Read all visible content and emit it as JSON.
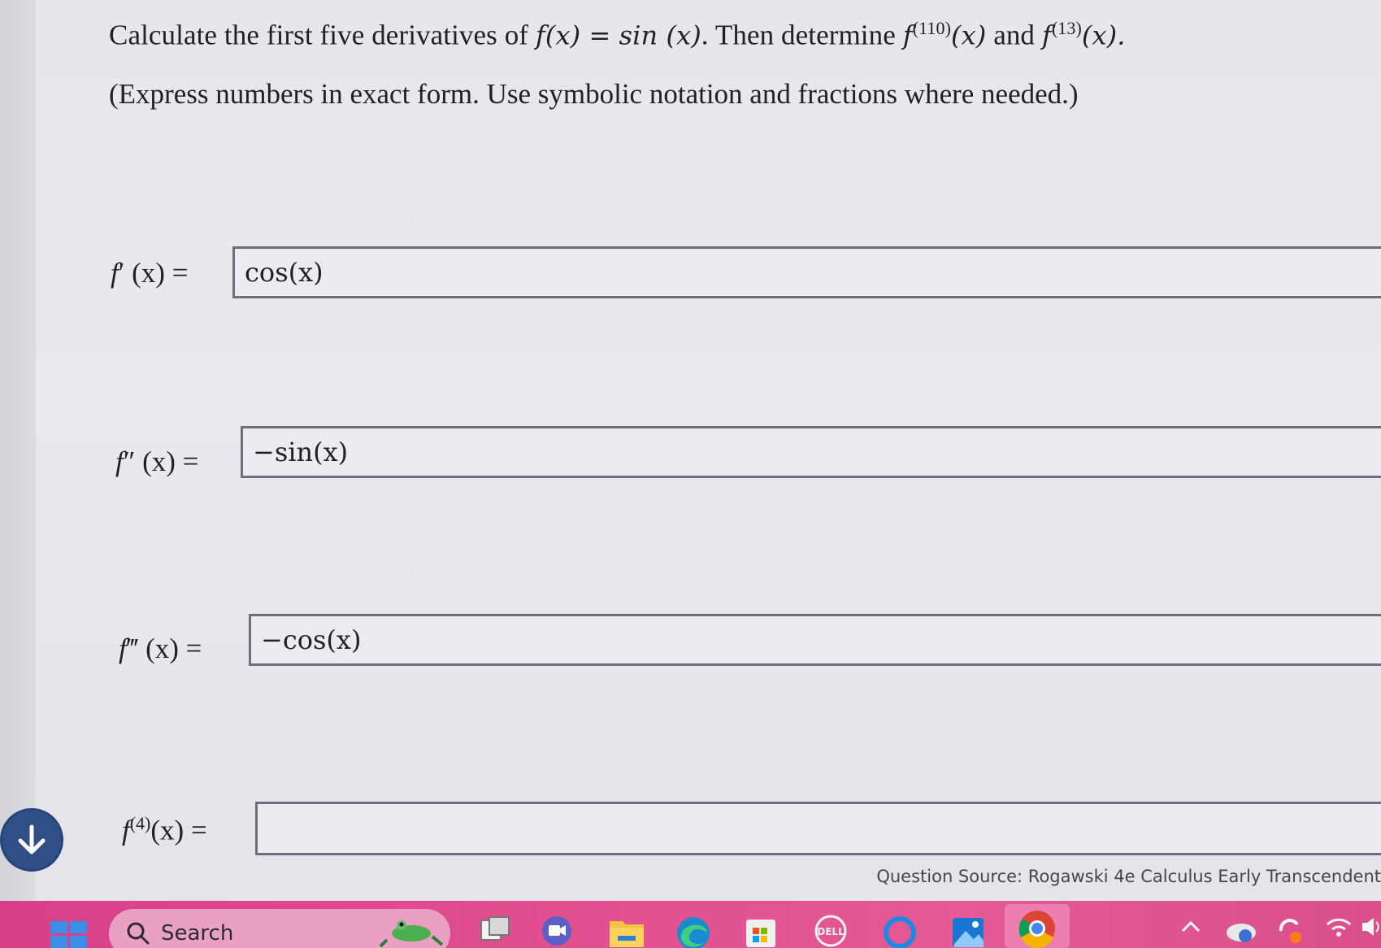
{
  "question": {
    "prefix": "Calculate the first five derivatives of ",
    "fx": "f(x) = sin (x)",
    "middle": ". Then determine ",
    "f110_base": "f",
    "f110_sup": "(110)",
    "f110_arg": "(x)",
    "and": " and ",
    "f13_base": "f",
    "f13_sup": "(13)",
    "f13_arg": "(x)."
  },
  "instruction": "(Express numbers in exact form. Use symbolic notation and fractions where needed.)",
  "rows": [
    {
      "label_fn": "f",
      "label_mark": "′",
      "label_rest": "(x) =",
      "value": "cos(x)"
    },
    {
      "label_fn": "f",
      "label_mark": "″",
      "label_rest": "(x) =",
      "value": "−sin(x)"
    },
    {
      "label_fn": "f",
      "label_mark": "‴",
      "label_rest": "(x) =",
      "value": "−cos(x)"
    },
    {
      "label_fn": "f",
      "label_sup": "(4)",
      "label_rest": "(x) =",
      "value": ""
    }
  ],
  "source": "Question Source: Rogawski 4e Calculus Early Transcendent",
  "taskbar": {
    "search_label": "Search",
    "icons": [
      "windows-start-icon",
      "search-icon",
      "frog-widget-icon",
      "task-view-icon",
      "meet-camera-icon",
      "file-explorer-icon",
      "edge-icon",
      "store-icon",
      "dell-icon",
      "cortana-icon",
      "photos-icon",
      "chrome-icon",
      "chevron-up-icon",
      "cloud-sync-icon",
      "refresh-icon",
      "wifi-icon",
      "volume-icon"
    ]
  },
  "colors": {
    "taskbar": "#e14f8f",
    "down_button": "#2f4f86",
    "box_border": "#6d7079"
  }
}
